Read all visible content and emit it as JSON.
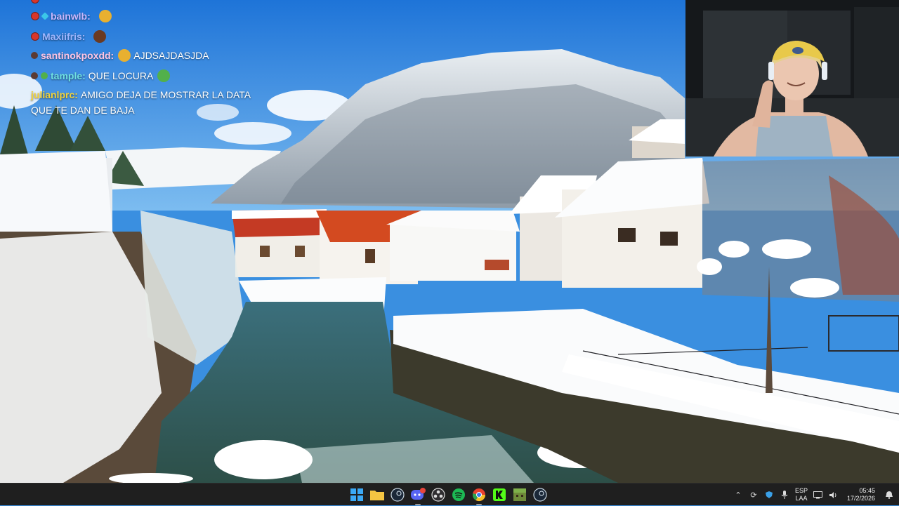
{
  "chat": {
    "messages": [
      {
        "user": "bainwlb:",
        "text": "",
        "user_color": "#c9b8ff",
        "badges": [
          "red",
          "gem"
        ],
        "emote": "#e8b030"
      },
      {
        "user": "Maxiifris:",
        "text": "",
        "user_color": "#9fb6ff",
        "badges": [
          "red"
        ],
        "emote": "#6a3a22"
      },
      {
        "user": "santinokpoxdd:",
        "text": "AJDSAJDASJDA",
        "user_color": "#ffc6e6",
        "badges": [
          "dark"
        ],
        "emote": "#e8b030"
      },
      {
        "user": "tample:",
        "text": "QUE LOCURA",
        "user_color": "#6fe0e0",
        "badges": [
          "dark",
          "frog"
        ],
        "emote": "#52b04b"
      },
      {
        "user": "julianlprc:",
        "text": "AMIGO DEJA DE MOSTRAR LA DATA",
        "user_color": "#f2d33a",
        "badges": [],
        "emote": ""
      },
      {
        "user": "",
        "text": "QUE TE DAN DE BAJA",
        "user_color": "#ffffff",
        "badges": [],
        "emote": ""
      }
    ]
  },
  "taskbar": {
    "apps": [
      {
        "name": "windows-start",
        "color": "#3ba9f5",
        "active": false
      },
      {
        "name": "file-explorer",
        "color": "#f4c542",
        "active": false
      },
      {
        "name": "steam",
        "color": "#1b2838",
        "active": false
      },
      {
        "name": "discord",
        "color": "#5865f2",
        "active": true,
        "badge": "99"
      },
      {
        "name": "obs",
        "color": "#302e31",
        "active": false
      },
      {
        "name": "spotify",
        "color": "#1db954",
        "active": false
      },
      {
        "name": "chrome",
        "color": "#e9412f",
        "active": true
      },
      {
        "name": "kick",
        "color": "#53fc18",
        "active": false
      },
      {
        "name": "minecraft",
        "color": "#6f8b3a",
        "active": false
      },
      {
        "name": "steam-2",
        "color": "#1b2838",
        "active": false
      }
    ],
    "tray": {
      "lang_top": "ESP",
      "lang_bottom": "LAA",
      "time": "05:45",
      "date": "17/2/2026"
    }
  }
}
